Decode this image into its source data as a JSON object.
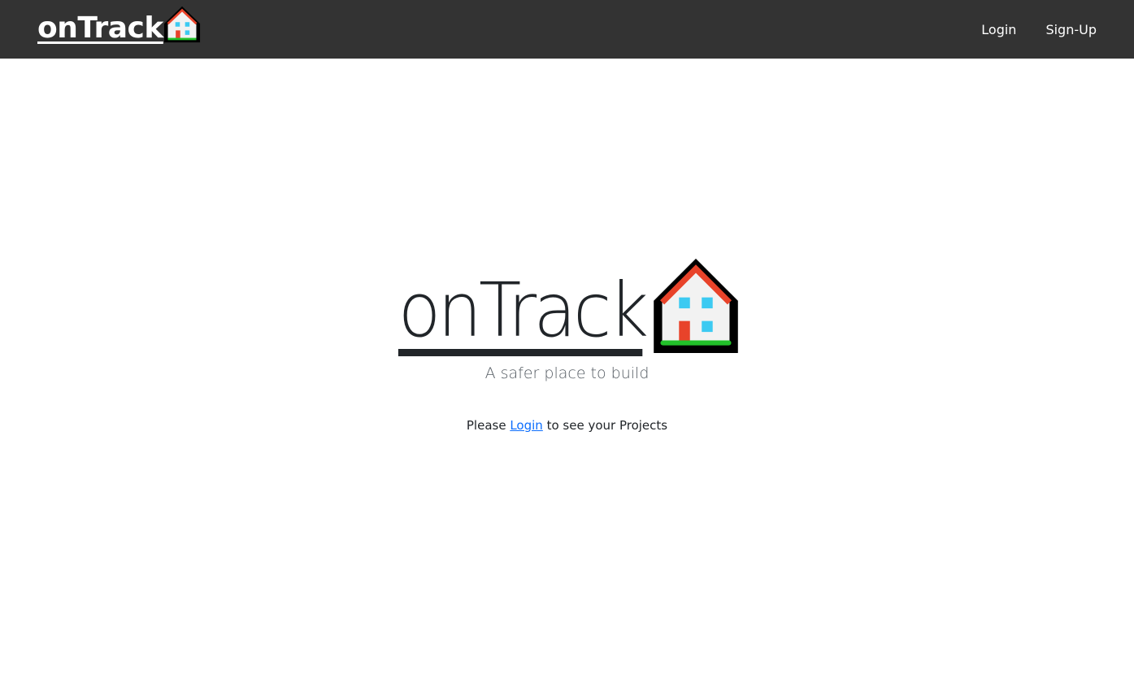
{
  "navbar": {
    "brand_label": "onTrack",
    "brand_icon": "house-icon",
    "links": [
      {
        "label": "Login"
      },
      {
        "label": "Sign-Up"
      }
    ],
    "background": "#333333"
  },
  "hero": {
    "title": "onTrack",
    "icon": "house-icon",
    "tagline": "A safer place to build"
  },
  "login_prompt": {
    "prefix": "Please ",
    "link_label": "Login",
    "suffix": " to see your Projects"
  },
  "colors": {
    "link": "#0d6efd",
    "text": "#212529",
    "roof": "#e8432a",
    "window": "#3ccaf2",
    "grass": "#22c12a"
  }
}
